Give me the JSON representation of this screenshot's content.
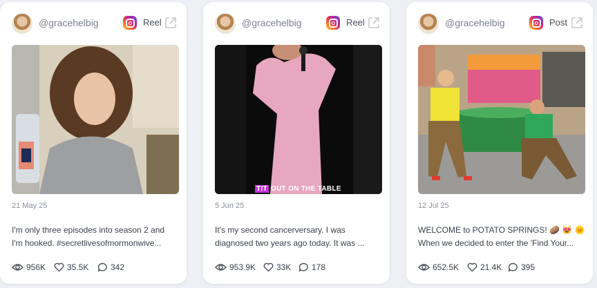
{
  "cards": [
    {
      "handle": "@gracehelbig",
      "platform_icon": "instagram-icon",
      "post_type": "Reel",
      "date": "21 May 25",
      "caption_line1": "I'm only three episodes into season 2 and",
      "caption_line2": "I'm hooked. #secretlivesofmormonwive...",
      "views": "956K",
      "likes": "35.5K",
      "comments": "342",
      "media_overlay_text": ""
    },
    {
      "handle": "@gracehelbig",
      "platform_icon": "instagram-icon",
      "post_type": "Reel",
      "date": "5 Jun 25",
      "caption_line1": "It's my second cancerversary. I was",
      "caption_line2": "diagnosed two years ago today. It was ...",
      "views": "953.9K",
      "likes": "33K",
      "comments": "178",
      "media_overlay_text": "TIT OUT ON THE TABLE"
    },
    {
      "handle": "@gracehelbig",
      "platform_icon": "instagram-icon",
      "post_type": "Post",
      "date": "12 Jul 25",
      "caption_line1": "WELCOME to POTATO SPRINGS! 🥔 😻 🌞",
      "caption_line2": "When we decided to enter the 'Find Your...",
      "views": "652.5K",
      "likes": "21.4K",
      "comments": "395",
      "media_overlay_text": ""
    }
  ],
  "colors": {
    "background": "#eef0f5",
    "card": "#ffffff",
    "muted_text": "#8a8f99",
    "body_text": "#3a3f48",
    "overlay_highlight": "#c533d6"
  }
}
